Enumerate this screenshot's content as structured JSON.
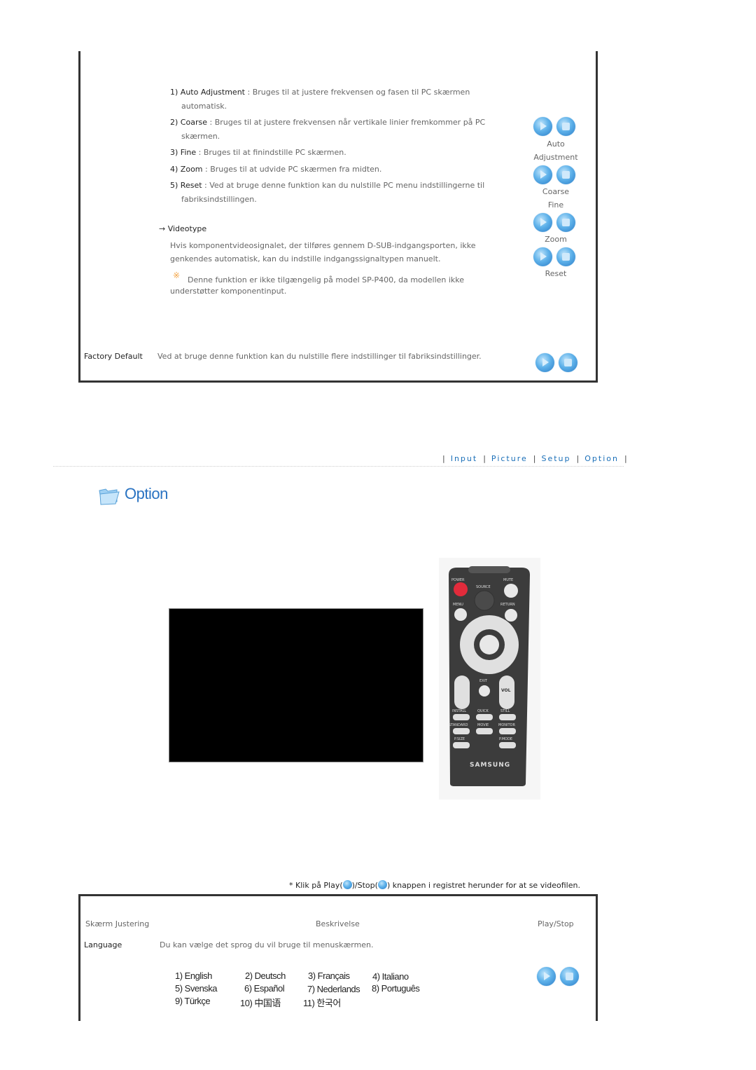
{
  "pc_adjust": {
    "items": [
      {
        "num": "1)",
        "term": "Auto Adjustment",
        "sep": " : ",
        "desc": "Bruges til at justere frekvensen og fasen til PC skærmen",
        "cont": "automatisk."
      },
      {
        "num": "2)",
        "term": "Coarse",
        "sep": " : ",
        "desc": "Bruges til at justere frekvensen når vertikale linier fremkommer på PC",
        "cont": "skærmen."
      },
      {
        "num": "3)",
        "term": "Fine",
        "sep": " : ",
        "desc": "Bruges til at finindstille PC skærmen.",
        "cont": ""
      },
      {
        "num": "4)",
        "term": "Zoom",
        "sep": " : ",
        "desc": "Bruges til at udvide PC skærmen fra midten.",
        "cont": ""
      },
      {
        "num": "5)",
        "term": "Reset",
        "sep": " : ",
        "desc": "Ved at bruge denne funktion kan du nulstille PC menu indstillingerne til",
        "cont": "fabriksindstillingen."
      }
    ],
    "videotype": {
      "arrow": "→",
      "title": "Videotype",
      "line1": "Hvis komponentvideosignalet, der tilføres gennem D-SUB-indgangsporten, ikke",
      "line2": "genkendes automatisk, kan du indstille indgangssignaltypen manuelt.",
      "note_mark": "※",
      "note1": "Denne funktion er ikke tilgængelig på model SP-P400, da modellen ikke",
      "note2": "understøtter komponentinput."
    },
    "side_labels": {
      "auto1": "Auto",
      "auto2": "Adjustment",
      "coarse": "Coarse",
      "fine": "Fine",
      "zoom": "Zoom",
      "reset": "Reset"
    },
    "factory_default": {
      "term": "Factory Default",
      "desc": "Ved at bruge denne funktion kan du nulstille flere indstillinger til fabriksindstillinger."
    }
  },
  "nav": {
    "items": [
      "Input",
      "Picture",
      "Setup",
      "Option"
    ],
    "sep": "|"
  },
  "section": {
    "title": "Option",
    "icon": "folder-icon"
  },
  "remote": {
    "brand": "SAMSUNG",
    "labels": {
      "power": "POWER",
      "mute": "MUTE",
      "source": "SOURCE",
      "menu": "MENU",
      "return": "RETURN",
      "exit": "EXIT",
      "vol": "VOL",
      "install": "INSTALL",
      "quick": "QUICK",
      "still": "STILL",
      "standard": "STANDARD",
      "movie": "MOVIE",
      "monitor": "MONITOR",
      "psize": "P.SIZE",
      "pmode": "P.MODE"
    }
  },
  "instruction": {
    "prefix": "* Klik på Play(",
    "mid": ")/Stop(",
    "suffix": ") knappen i registret herunder for at se videofilen."
  },
  "table": {
    "headers": [
      "Skærm Justering",
      "Beskrivelse",
      "Play/Stop"
    ],
    "rows": [
      {
        "term": "Language",
        "desc": "Du kan vælge det sprog du vil bruge til menuskærmen."
      }
    ],
    "languages": [
      [
        "1) English",
        "2) Deutsch",
        "3) Français",
        "4) Italiano"
      ],
      [
        "5) Svenska",
        "6) Español",
        "7) Nederlands",
        "8) Português"
      ],
      [
        "9) Türkçe",
        "10) 中国语",
        "11) 한국어"
      ]
    ]
  }
}
